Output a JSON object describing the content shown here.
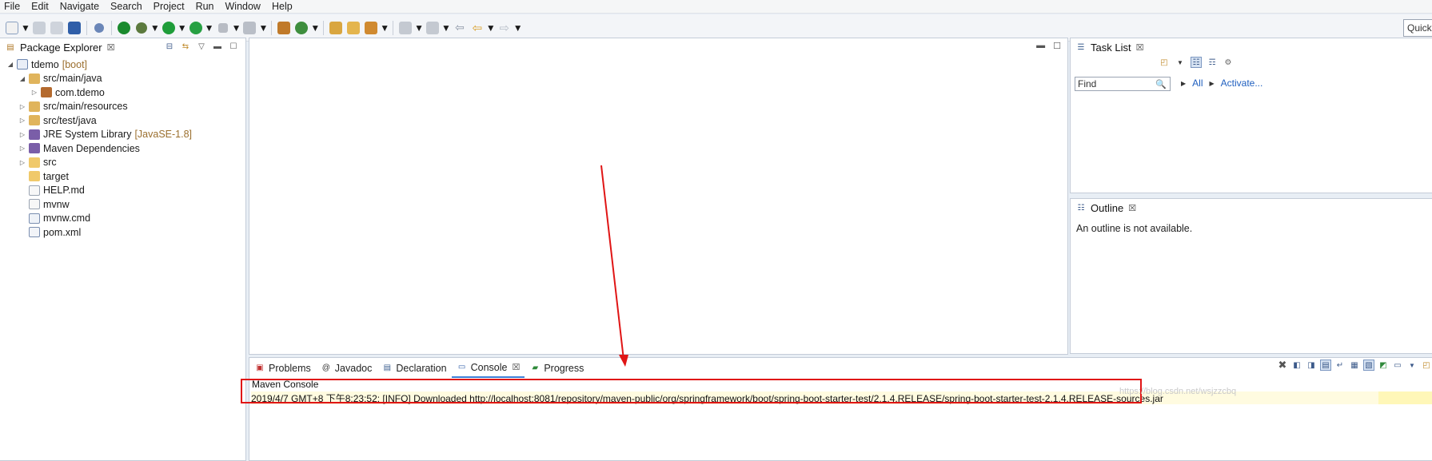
{
  "menu": [
    "File",
    "Edit",
    "Navigate",
    "Search",
    "Project",
    "Run",
    "Window",
    "Help"
  ],
  "quick_access_label": "Quick",
  "package_explorer": {
    "title": "Package Explorer",
    "tree": [
      {
        "label": "tdemo",
        "decoration": "[boot]",
        "level": 0,
        "arrow": "◢",
        "icon": "project-icon"
      },
      {
        "label": "src/main/java",
        "decoration": "",
        "level": 1,
        "arrow": "◢",
        "icon": "source-folder-icon"
      },
      {
        "label": "com.tdemo",
        "decoration": "",
        "level": 2,
        "arrow": "▷",
        "icon": "package-icon"
      },
      {
        "label": "src/main/resources",
        "decoration": "",
        "level": 1,
        "arrow": "▷",
        "icon": "source-folder-icon"
      },
      {
        "label": "src/test/java",
        "decoration": "",
        "level": 1,
        "arrow": "▷",
        "icon": "source-folder-icon"
      },
      {
        "label": "JRE System Library",
        "decoration": "[JavaSE-1.8]",
        "level": 1,
        "arrow": "▷",
        "icon": "library-icon"
      },
      {
        "label": "Maven Dependencies",
        "decoration": "",
        "level": 1,
        "arrow": "▷",
        "icon": "library-icon"
      },
      {
        "label": "src",
        "decoration": "",
        "level": 1,
        "arrow": "▷",
        "icon": "folder-icon"
      },
      {
        "label": "target",
        "decoration": "",
        "level": 1,
        "arrow": "",
        "icon": "folder-icon"
      },
      {
        "label": "HELP.md",
        "decoration": "",
        "level": 1,
        "arrow": "",
        "icon": "file-icon"
      },
      {
        "label": "mvnw",
        "decoration": "",
        "level": 1,
        "arrow": "",
        "icon": "file-icon"
      },
      {
        "label": "mvnw.cmd",
        "decoration": "",
        "level": 1,
        "arrow": "",
        "icon": "cmd-file-icon"
      },
      {
        "label": "pom.xml",
        "decoration": "",
        "level": 1,
        "arrow": "",
        "icon": "maven-pom-icon"
      }
    ]
  },
  "task_list": {
    "title": "Task List",
    "find_placeholder": "Find",
    "filter_all": "All",
    "filter_activate": "Activate..."
  },
  "outline": {
    "title": "Outline",
    "message": "An outline is not available."
  },
  "console": {
    "tabs": [
      {
        "label": "Problems",
        "icon": "problems-icon"
      },
      {
        "label": "Javadoc",
        "icon": "at-icon"
      },
      {
        "label": "Declaration",
        "icon": "declaration-icon"
      },
      {
        "label": "Console",
        "icon": "console-icon"
      },
      {
        "label": "Progress",
        "icon": "progress-icon"
      }
    ],
    "active_tab": "Console",
    "title": "Maven Console",
    "line": "2019/4/7 GMT+8 下午8:23:52: [INFO] Downloaded http://localhost:8081/repository/maven-public/org/springframework/boot/spring-boot-starter-test/2.1.4.RELEASE/spring-boot-starter-test-2.1.4.RELEASE-sources.jar",
    "watermark": "https://blog.csdn.net/wsjzzcbq"
  },
  "colors": {
    "annotation_red": "#e01515",
    "accent_blue": "#3c7fd6"
  }
}
